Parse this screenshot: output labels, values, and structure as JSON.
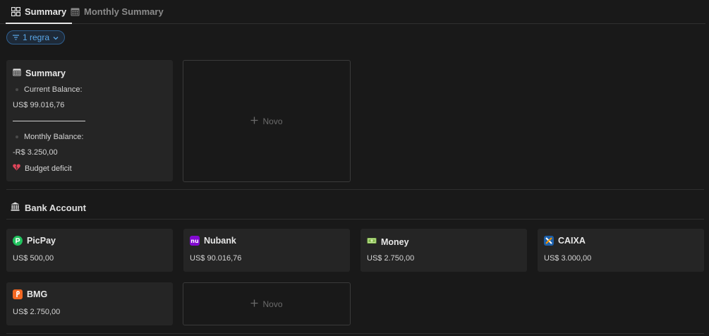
{
  "tabs": [
    {
      "label": "Summary",
      "icon": "grid-icon",
      "active": true
    },
    {
      "label": "Monthly Summary",
      "icon": "calendar-icon",
      "active": false
    }
  ],
  "filter": {
    "label": "1 regra",
    "icon": "filter-icon"
  },
  "summary_card": {
    "title": "Summary",
    "current_balance_label": "Current Balance:",
    "current_balance_value": "US$ 99.016,76",
    "monthly_balance_label": "Monthly Balance:",
    "monthly_balance_value": "-R$ 3.250,00",
    "status_text": "Budget deficit",
    "status_icon": "broken-heart-icon"
  },
  "new_label": "Novo",
  "section": {
    "title": "Bank Account",
    "icon": "bank-icon"
  },
  "accounts": [
    {
      "name": "PicPay",
      "value": "US$ 500,00",
      "color": "#21c25e"
    },
    {
      "name": "Nubank",
      "value": "US$ 90.016,76",
      "color": "#820ad1"
    },
    {
      "name": "Money",
      "value": "US$ 2.750,00",
      "color": "#7fb74a"
    },
    {
      "name": "CAIXA",
      "value": "US$ 3.000,00",
      "color": "#1c60ab"
    },
    {
      "name": "BMG",
      "value": "US$ 2.750,00",
      "color": "#f26722"
    }
  ],
  "colors": {
    "background": "#191919",
    "card": "#252525",
    "accent_blue": "#5aa7e8",
    "deficit_red": "#e0455a"
  }
}
